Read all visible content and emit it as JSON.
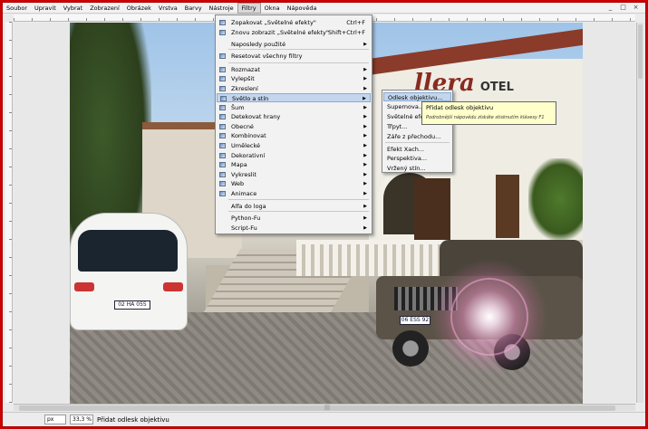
{
  "menubar": {
    "items": [
      "Soubor",
      "Upravit",
      "Vybrat",
      "Zobrazení",
      "Obrázek",
      "Vrstva",
      "Barvy",
      "Nástroje",
      "Filtry",
      "Okna",
      "Nápověda"
    ],
    "active": "Filtry",
    "window_controls": [
      "_",
      "□",
      "×"
    ]
  },
  "filters_menu": {
    "items": [
      {
        "label": "Zopakovat „Světelné efekty\"",
        "accel": "Ctrl+F",
        "submenu": false,
        "icon": "repeat-icon"
      },
      {
        "label": "Znovu zobrazit „Světelné efekty\"",
        "accel": "Shift+Ctrl+F",
        "submenu": false,
        "icon": "reshow-icon"
      },
      {
        "label": "Naposledy použité",
        "accel": "",
        "submenu": true,
        "icon": ""
      },
      {
        "label": "Resetovat všechny filtry",
        "accel": "",
        "submenu": false,
        "icon": "reset-icon"
      },
      {
        "label": "Rozmazat",
        "accel": "",
        "submenu": true,
        "icon": "blur-icon"
      },
      {
        "label": "Vylepšit",
        "accel": "",
        "submenu": true,
        "icon": "enhance-icon"
      },
      {
        "label": "Zkreslení",
        "accel": "",
        "submenu": true,
        "icon": "distort-icon"
      },
      {
        "label": "Světlo a stín",
        "accel": "",
        "submenu": true,
        "icon": "light-shadow-icon"
      },
      {
        "label": "Šum",
        "accel": "",
        "submenu": true,
        "icon": "noise-icon"
      },
      {
        "label": "Detekovat hrany",
        "accel": "",
        "submenu": true,
        "icon": "edge-icon"
      },
      {
        "label": "Obecné",
        "accel": "",
        "submenu": true,
        "icon": "generic-icon"
      },
      {
        "label": "Kombinovat",
        "accel": "",
        "submenu": true,
        "icon": "combine-icon"
      },
      {
        "label": "Umělecké",
        "accel": "",
        "submenu": true,
        "icon": "artistic-icon"
      },
      {
        "label": "Dekorativní",
        "accel": "",
        "submenu": true,
        "icon": "decor-icon"
      },
      {
        "label": "Mapa",
        "accel": "",
        "submenu": true,
        "icon": "map-icon"
      },
      {
        "label": "Vykreslit",
        "accel": "",
        "submenu": true,
        "icon": "render-icon"
      },
      {
        "label": "Web",
        "accel": "",
        "submenu": true,
        "icon": "web-icon"
      },
      {
        "label": "Animace",
        "accel": "",
        "submenu": true,
        "icon": "animation-icon"
      },
      {
        "label": "Alfa do loga",
        "accel": "",
        "submenu": true,
        "icon": ""
      },
      {
        "label": "Python-Fu",
        "accel": "",
        "submenu": true,
        "icon": ""
      },
      {
        "label": "Script-Fu",
        "accel": "",
        "submenu": true,
        "icon": ""
      }
    ],
    "highlighted": "Světlo a stín"
  },
  "light_shadow_submenu": {
    "items": [
      "Odlesk objektivu...",
      "Supernova...",
      "Světelné efekty...",
      "Třpyt...",
      "Záře z přechodu...",
      "Efekt Xach...",
      "Perspektiva...",
      "Vržený stín..."
    ],
    "highlighted": "Odlesk objektivu..."
  },
  "tooltip": {
    "title": "Přidat odlesk objektivu",
    "help": "Podrobnější nápovědu získáte stisknutím klávesy F1"
  },
  "photo": {
    "hotel_sign": "llera",
    "hotel_sign_suffix": "OTEL",
    "van_plate": "02 HA 055",
    "jeep_plate": "06 ESS 92"
  },
  "statusbar": {
    "unit": "px",
    "zoom": "33,3 %",
    "message": "Přidat odlesk objektivu"
  },
  "colors": {
    "menu_highlight": "#c3d6ee",
    "tooltip_bg": "#ffffcc",
    "window_border": "#cc0000"
  }
}
